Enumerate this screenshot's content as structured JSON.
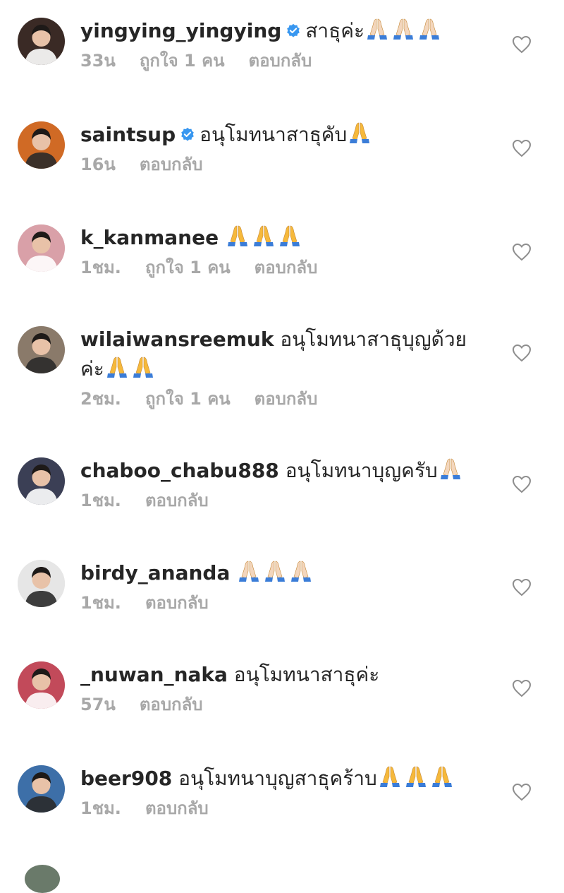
{
  "comments": [
    {
      "username": "yingying_yingying",
      "verified": true,
      "text": " สาธุค่ะ",
      "emoji": [
        "light",
        "light",
        "light"
      ],
      "time": "33น",
      "likes": "ถูกใจ 1 คน",
      "reply": "ตอบกลับ",
      "avatar_color": "#3a2a25"
    },
    {
      "username": "saintsup",
      "verified": true,
      "text": " อนุโมทนาสาธุคับ",
      "emoji": [
        "yellow"
      ],
      "time": "16น",
      "likes": "",
      "reply": "ตอบกลับ",
      "avatar_color": "#d06a25"
    },
    {
      "username": "k_kanmanee",
      "verified": false,
      "text": " ",
      "emoji": [
        "yellow",
        "yellow",
        "yellow"
      ],
      "time": "1ชม.",
      "likes": "ถูกใจ 1 คน",
      "reply": "ตอบกลับ",
      "avatar_color": "#d9a0a8"
    },
    {
      "username": "wilaiwansreemuk",
      "verified": false,
      "text": " อนุโมทนาสาธุบุญด้วยค่ะ",
      "emoji": [
        "yellow",
        "yellow"
      ],
      "time": "2ชม.",
      "likes": "ถูกใจ 1 คน",
      "reply": "ตอบกลับ",
      "avatar_color": "#8a7a6a"
    },
    {
      "username": "chaboo_chabu888",
      "verified": false,
      "text": " อนุโมทนาบุญครับ",
      "emoji": [
        "light"
      ],
      "time": "1ชม.",
      "likes": "",
      "reply": "ตอบกลับ",
      "avatar_color": "#3b3f55"
    },
    {
      "username": "birdy_ananda",
      "verified": false,
      "text": " ",
      "emoji": [
        "light",
        "light",
        "light"
      ],
      "time": "1ชม.",
      "likes": "",
      "reply": "ตอบกลับ",
      "avatar_color": "#e6e6e6"
    },
    {
      "username": "_nuwan_naka",
      "verified": false,
      "text": " อนุโมทนาสาธุค่ะ",
      "emoji": [],
      "time": "57น",
      "likes": "",
      "reply": "ตอบกลับ",
      "avatar_color": "#c24a5a"
    },
    {
      "username": "beer908",
      "verified": false,
      "text": " อนุโมทนาบุญสาธุคร้าบ",
      "emoji": [
        "yellow",
        "yellow",
        "yellow"
      ],
      "time": "1ชม.",
      "likes": "",
      "reply": "ตอบกลับ",
      "avatar_color": "#3d6fa8"
    }
  ],
  "colors": {
    "verified": "#3897f0",
    "meta": "#a8a8a8",
    "text": "#262626",
    "emoji_yellow": "#f6b93b",
    "emoji_light": "#f3d6bd",
    "emoji_sleeve": "#3b7dd8"
  },
  "icons": {
    "heart": "heart-outline-icon",
    "verified": "verified-badge-icon",
    "emoji": "folded-hands-emoji"
  }
}
